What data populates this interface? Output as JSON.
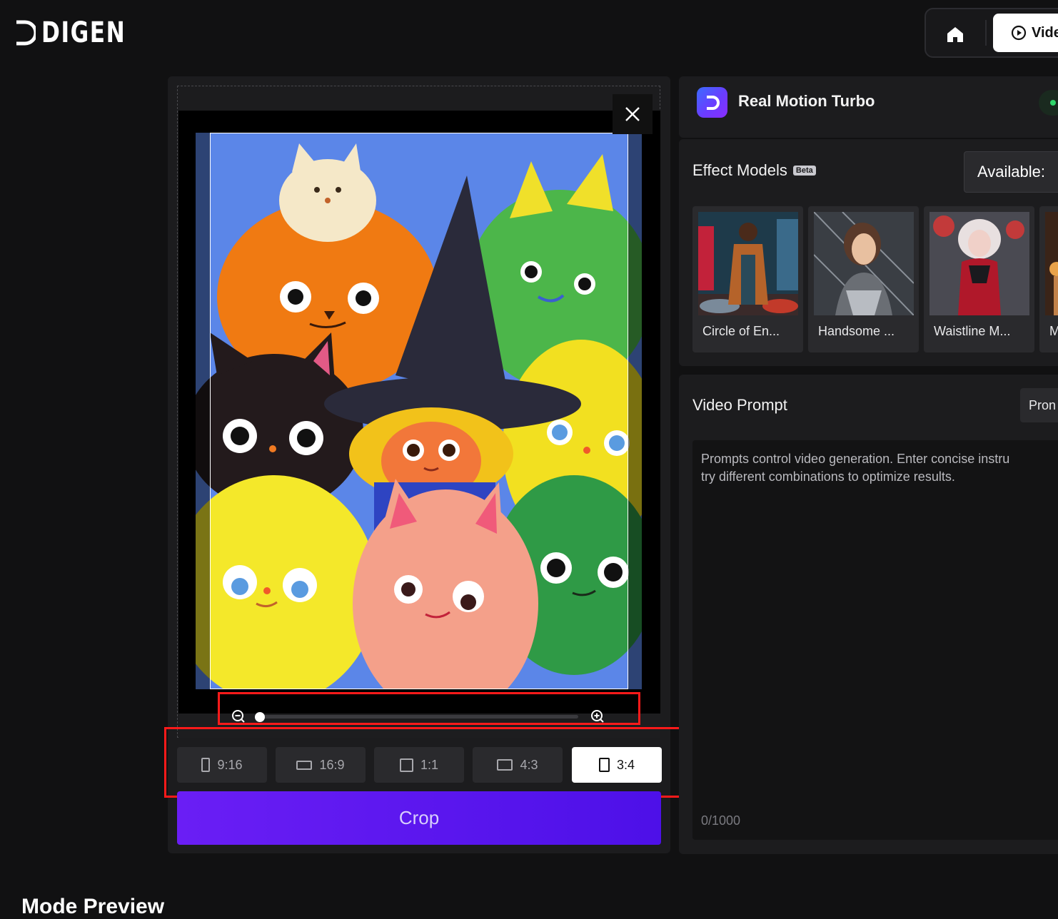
{
  "header": {
    "logo_text": "DIGEN",
    "nav": {
      "home_icon": "home-icon",
      "video_tab_label": "Vide",
      "video_tab_icon": "video-play-icon"
    }
  },
  "editor": {
    "close_icon": "close-icon",
    "zoom": {
      "out_icon": "zoom-out-icon",
      "in_icon": "zoom-in-icon",
      "level": 0.0
    },
    "aspect_ratios": [
      {
        "label": "9:16",
        "icon": "portrait-ratio-icon",
        "selected": false
      },
      {
        "label": "16:9",
        "icon": "landscape-ratio-icon",
        "selected": false
      },
      {
        "label": "1:1",
        "icon": "square-ratio-icon",
        "selected": false
      },
      {
        "label": "4:3",
        "icon": "landscape-ratio-icon",
        "selected": false
      },
      {
        "label": "3:4",
        "icon": "portrait-ratio-icon",
        "selected": true
      }
    ],
    "crop_label": "Crop",
    "accent_color": "#5a14f0",
    "highlight_color": "#ff1a1a"
  },
  "model": {
    "name": "Real Motion Turbo",
    "icon": "digen-model-icon",
    "status_color": "#2fd66a"
  },
  "effects": {
    "title": "Effect Models",
    "badge": "Beta",
    "available_label": "Available:",
    "items": [
      {
        "label": "Circle of En..."
      },
      {
        "label": "Handsome ..."
      },
      {
        "label": "Waistline M..."
      },
      {
        "label": "M"
      }
    ]
  },
  "prompt": {
    "title": "Video Prompt",
    "button_label": "Pron",
    "placeholder_line1": "Prompts control video generation. Enter concise instru",
    "placeholder_line2": "try different combinations to optimize results.",
    "counter": "0/1000"
  },
  "footer": {
    "heading": "Mode Preview"
  }
}
